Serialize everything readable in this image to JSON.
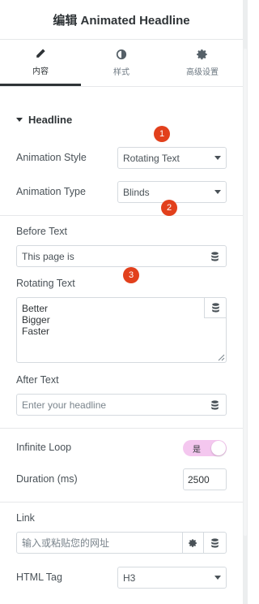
{
  "header": {
    "title": "编辑 Animated Headline"
  },
  "tabs": [
    {
      "label": "内容",
      "icon": "pencil-icon",
      "active": true
    },
    {
      "label": "样式",
      "icon": "half-circle-icon",
      "active": false
    },
    {
      "label": "高级设置",
      "icon": "gear-icon",
      "active": false
    }
  ],
  "section": {
    "title": "Headline"
  },
  "fields": {
    "animation_style": {
      "label": "Animation Style",
      "value": "Rotating Text"
    },
    "animation_type": {
      "label": "Animation Type",
      "value": "Blinds"
    },
    "before_text": {
      "label": "Before Text",
      "value": "This page is"
    },
    "rotating_text": {
      "label": "Rotating Text",
      "lines": [
        "Better",
        "Bigger",
        "Faster"
      ]
    },
    "after_text": {
      "label": "After Text",
      "placeholder": "Enter your headline"
    },
    "infinite_loop": {
      "label": "Infinite Loop",
      "toggle_label": "是",
      "on": true
    },
    "duration": {
      "label": "Duration (ms)",
      "value": "2500"
    },
    "link": {
      "label": "Link",
      "placeholder": "输入或粘贴您的网址"
    },
    "html_tag": {
      "label": "HTML Tag",
      "value": "H3"
    }
  },
  "badges": [
    "1",
    "2",
    "3"
  ],
  "colors": {
    "badge": "#e2401c",
    "toggle_on": "#f4c7ef",
    "active_tab": "#2f3437"
  }
}
